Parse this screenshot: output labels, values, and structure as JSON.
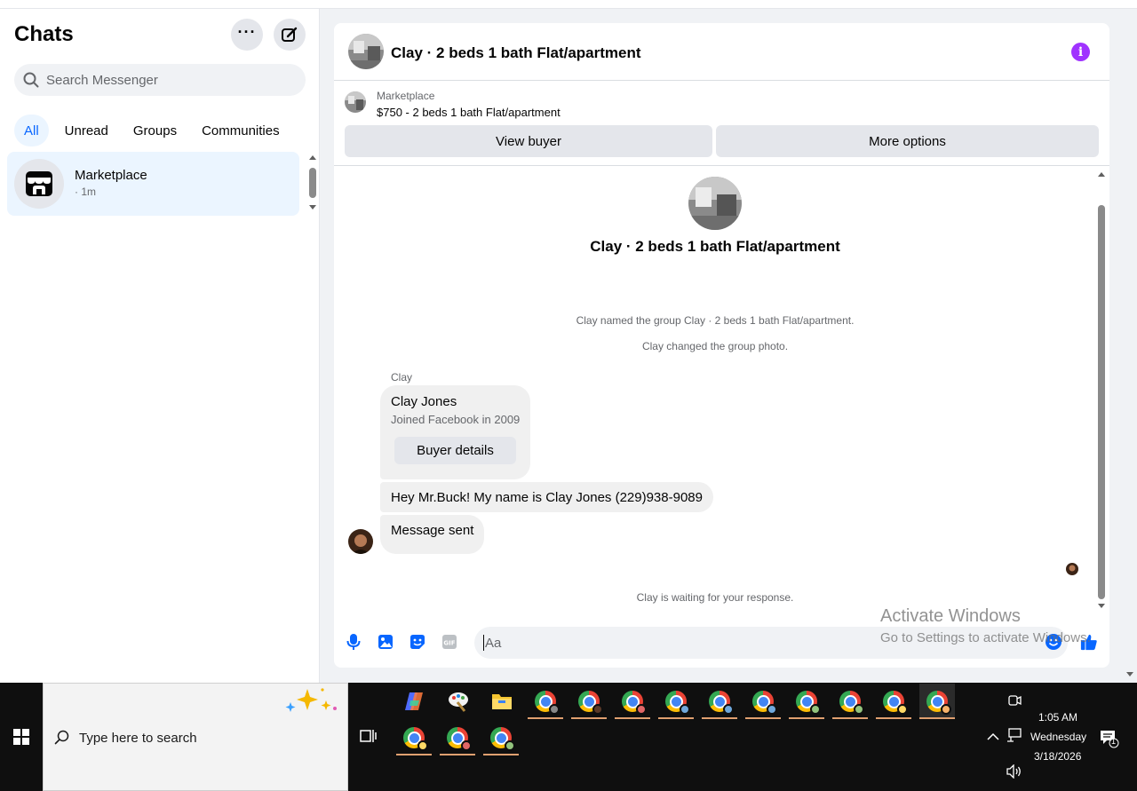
{
  "sidebar": {
    "title": "Chats",
    "search_placeholder": "Search Messenger",
    "filters": [
      "All",
      "Unread",
      "Groups",
      "Communities"
    ],
    "chat_item": {
      "name": "Marketplace",
      "time": "· 1m"
    }
  },
  "header": {
    "title": "Clay · 2 beds 1 bath Flat/apartment"
  },
  "listing": {
    "label": "Marketplace",
    "title": "$750 - 2 beds 1 bath Flat/apartment",
    "view_buyer": "View buyer",
    "more_options": "More options"
  },
  "conversation": {
    "title": "Clay · 2 beds 1 bath Flat/apartment",
    "system_messages": [
      "Clay named the group Clay · 2 beds 1 bath Flat/apartment.",
      "Clay changed the group photo."
    ],
    "sender": "Clay",
    "buyer_card": {
      "name": "Clay Jones",
      "subtitle": "Joined Facebook in 2009",
      "button": "Buyer details"
    },
    "message": "Hey Mr.Buck! My name is Clay Jones (229)938-9089",
    "sent_message": "Message sent",
    "waiting": "Clay is waiting for your response."
  },
  "composer": {
    "placeholder": "Aa",
    "icons": [
      "microphone-icon",
      "image-icon",
      "sticker-icon",
      "gif-icon",
      "emoji-icon",
      "thumbs-up-icon"
    ]
  },
  "watermark": {
    "line1": "Activate Windows",
    "line2": "Go to Settings to activate Windows."
  },
  "taskbar": {
    "search_placeholder": "Type here to search",
    "time": "1:05 AM",
    "day": "Wednesday",
    "date": "3/18/2026",
    "notification_count": "1"
  },
  "colors": {
    "accent": "#0866ff",
    "info": "#a033ff",
    "bubble": "#f0f0f0",
    "selected": "#ebf5ff"
  }
}
